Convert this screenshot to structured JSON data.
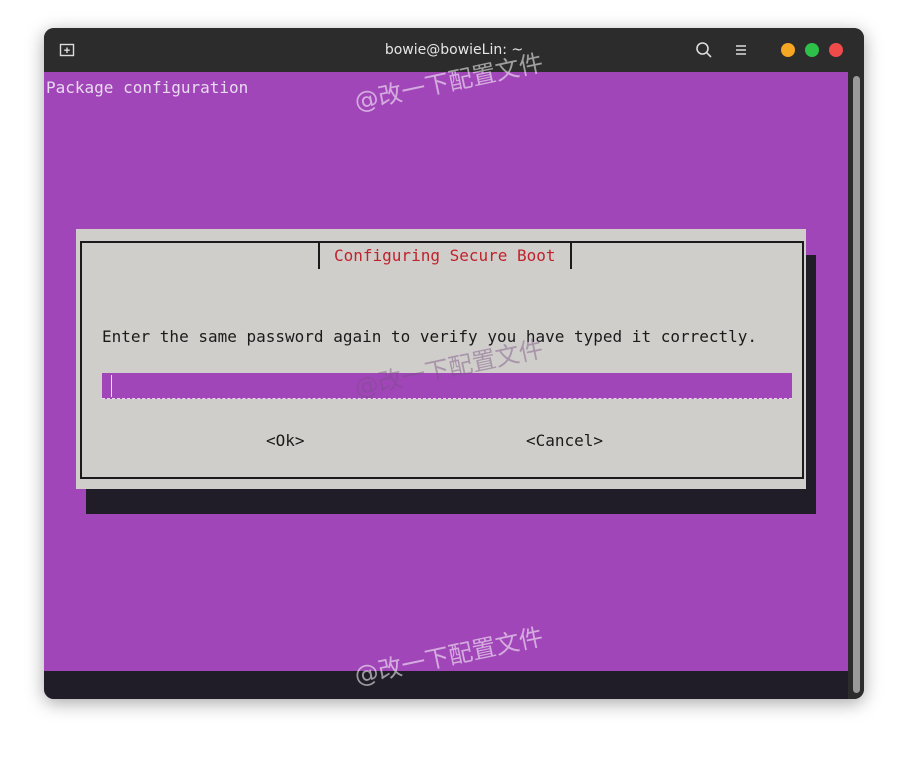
{
  "window": {
    "title": "bowie@bowieLin: ~",
    "icons": {
      "new_tab": "new-tab-icon",
      "search": "search-icon",
      "menu": "hamburger-menu-icon"
    },
    "controls": {
      "minimize_color": "#f5a623",
      "maximize_color": "#2ec14a",
      "close_color": "#ef4b4b"
    }
  },
  "terminal": {
    "header": "Package configuration",
    "background_color": "#a146b8"
  },
  "dialog": {
    "title": "Configuring Secure Boot",
    "prompt": "Enter the same password again to verify you have typed it correctly.",
    "password_value": "",
    "ok_label": "<Ok>",
    "cancel_label": "<Cancel>"
  },
  "watermark": {
    "text": "@改一下配置文件"
  }
}
